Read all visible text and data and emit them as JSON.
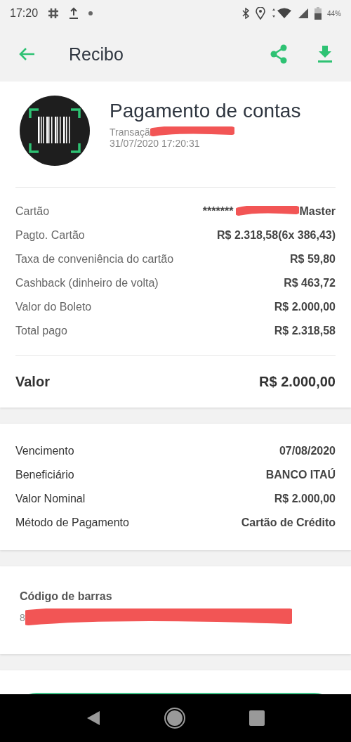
{
  "status_bar": {
    "time": "17:20",
    "battery": "44%"
  },
  "app_bar": {
    "title": "Recibo"
  },
  "header": {
    "title": "Pagamento de contas",
    "transaction": "Transaçã",
    "datetime": "31/07/2020 17:20:31"
  },
  "payment_rows": [
    {
      "label": "Cartão",
      "value": "*******",
      "value_tail": "Master",
      "redacted": true
    },
    {
      "label": "Pagto. Cartão",
      "value": "R$ 2.318,58(6x 386,43)",
      "redacted": false
    },
    {
      "label": "Taxa de conveniência do cartão",
      "value": "R$ 59,80",
      "redacted": false
    },
    {
      "label": "Cashback (dinheiro de volta)",
      "value": "R$ 463,72",
      "redacted": false
    },
    {
      "label": "Valor do Boleto",
      "value": "R$ 2.000,00",
      "redacted": false
    },
    {
      "label": "Total pago",
      "value": "R$ 2.318,58",
      "redacted": false
    }
  ],
  "total": {
    "label": "Valor",
    "value": "R$ 2.000,00"
  },
  "details": [
    {
      "label": "Vencimento",
      "value": "07/08/2020"
    },
    {
      "label": "Beneficiário",
      "value": "BANCO ITAÚ"
    },
    {
      "label": "Valor Nominal",
      "value": "R$ 2.000,00"
    },
    {
      "label": "Método de Pagamento",
      "value": "Cartão de Crédito"
    }
  ],
  "barcode": {
    "label": "Código de barras",
    "code": "8"
  }
}
